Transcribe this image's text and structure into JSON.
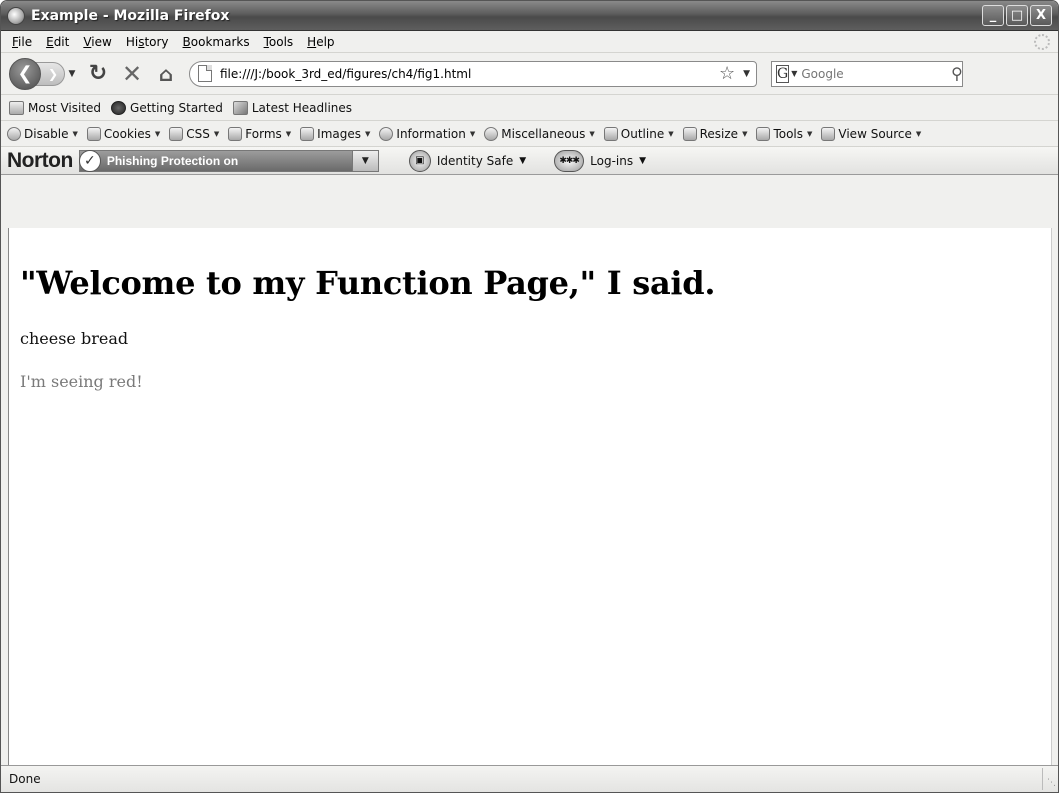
{
  "window": {
    "title": "Example - Mozilla Firefox",
    "controls": {
      "minimize": "_",
      "maximize": "□",
      "close": "X"
    }
  },
  "menu": [
    {
      "prefix": "",
      "mnemonic": "F",
      "rest": "ile"
    },
    {
      "prefix": "",
      "mnemonic": "E",
      "rest": "dit"
    },
    {
      "prefix": "",
      "mnemonic": "V",
      "rest": "iew"
    },
    {
      "prefix": "Hi",
      "mnemonic": "s",
      "rest": "tory"
    },
    {
      "prefix": "",
      "mnemonic": "B",
      "rest": "ookmarks"
    },
    {
      "prefix": "",
      "mnemonic": "T",
      "rest": "ools"
    },
    {
      "prefix": "",
      "mnemonic": "H",
      "rest": "elp"
    }
  ],
  "nav": {
    "url": "file:///J:/book_3rd_ed/figures/ch4/fig1.html",
    "search_placeholder": "Google",
    "search_engine_letter": "G"
  },
  "bookmarks": [
    {
      "label": "Most Visited",
      "icon": "most-visited-icon"
    },
    {
      "label": "Getting Started",
      "icon": "firefox-icon"
    },
    {
      "label": "Latest Headlines",
      "icon": "rss-icon"
    }
  ],
  "devtools": [
    {
      "label": "Disable",
      "icon": "disable-icon"
    },
    {
      "label": "Cookies",
      "icon": "cookies-icon"
    },
    {
      "label": "CSS",
      "icon": "css-icon"
    },
    {
      "label": "Forms",
      "icon": "forms-icon"
    },
    {
      "label": "Images",
      "icon": "images-icon"
    },
    {
      "label": "Information",
      "icon": "information-icon"
    },
    {
      "label": "Miscellaneous",
      "icon": "miscellaneous-icon"
    },
    {
      "label": "Outline",
      "icon": "outline-icon"
    },
    {
      "label": "Resize",
      "icon": "resize-icon"
    },
    {
      "label": "Tools",
      "icon": "tools-icon"
    },
    {
      "label": "View Source",
      "icon": "view-source-icon"
    }
  ],
  "norton": {
    "logo": "Norton",
    "phishing": "Phishing Protection on",
    "identity_safe": "Identity Safe",
    "logins": "Log-ins"
  },
  "page": {
    "heading": "\"Welcome to my Function Page,\" I said.",
    "para1": "cheese bread",
    "para2": "I'm seeing red!"
  },
  "status": {
    "text": "Done"
  }
}
